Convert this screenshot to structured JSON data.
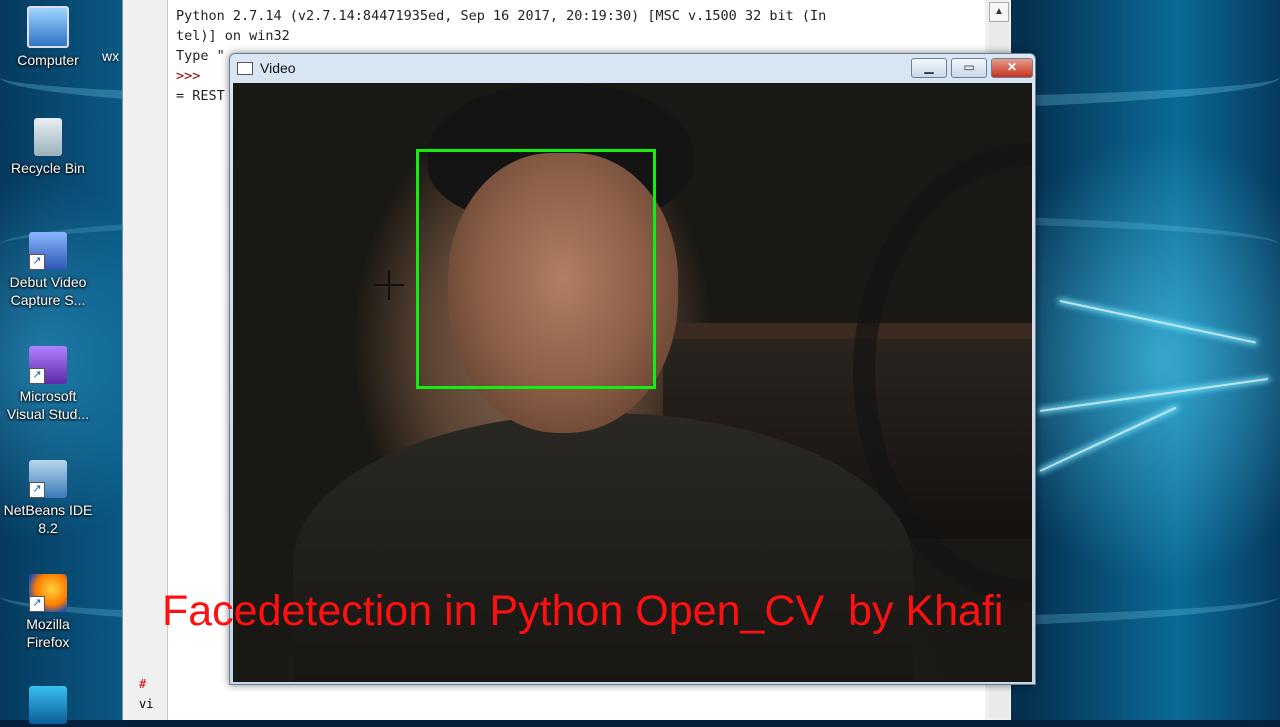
{
  "desktop": {
    "icons": [
      {
        "label": "Computer"
      },
      {
        "label": "Recycle Bin"
      },
      {
        "label": "Debut Video Capture S..."
      },
      {
        "label": "Microsoft Visual Stud..."
      },
      {
        "label": "NetBeans IDE 8.2"
      },
      {
        "label": "Mozilla Firefox"
      }
    ],
    "partial_label": "wx"
  },
  "shell": {
    "lines": [
      "Python 2.7.14 (v2.7.14:84471935ed, Sep 16 2017, 20:19:30) [MSC v.1500 32 bit (In",
      "tel)] on win32",
      "Type \"",
      ">>>",
      "= REST"
    ],
    "left_bits": [
      "#",
      "vi"
    ],
    "scroll_up": "▲"
  },
  "video_window": {
    "title": "Video",
    "minimize": "▁",
    "maximize": "▭",
    "close": "✕"
  },
  "overlay": {
    "caption": "Facedetection in Python Open_CV  by Khafi",
    "color": "#ff1010"
  },
  "colors": {
    "face_box": "#11ee11"
  }
}
